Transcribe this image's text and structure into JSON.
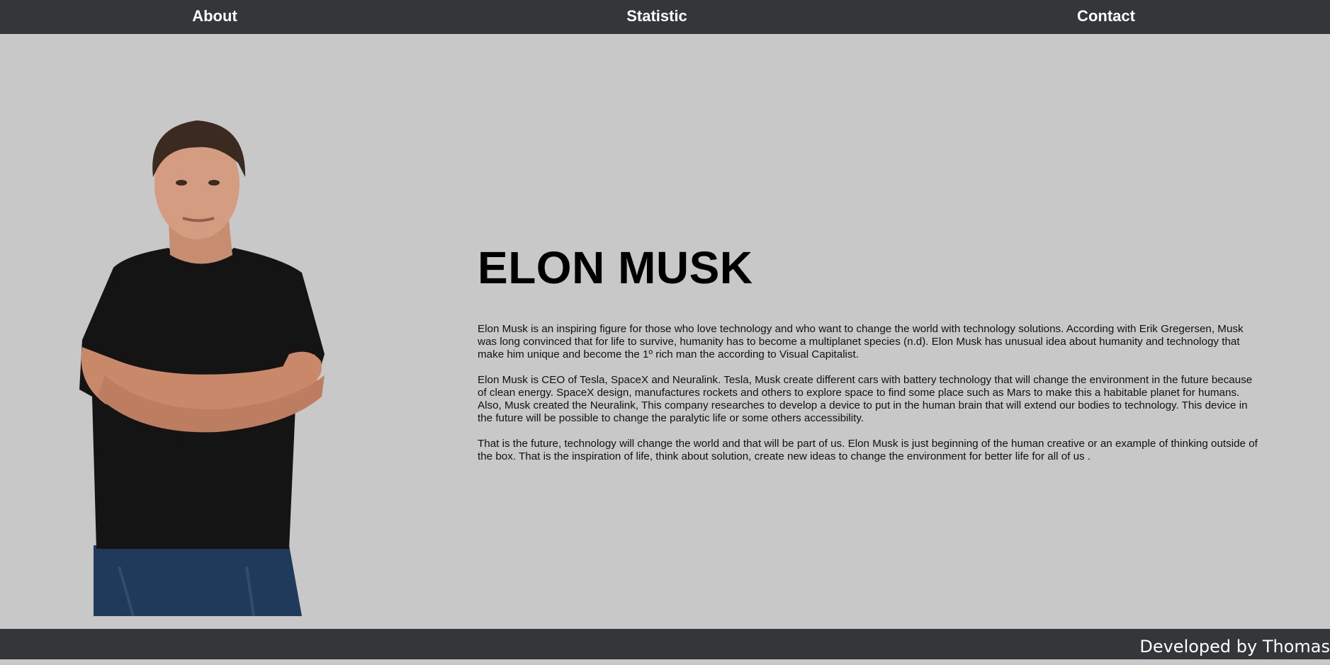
{
  "nav": {
    "about": "About",
    "statistic": "Statistic",
    "contact": "Contact"
  },
  "main": {
    "title": "ELON MUSK",
    "paragraphs": [
      "Elon Musk is an inspiring figure for those who love technology and who want to change the world with technology solutions. According with Erik Gregersen, Musk was long convinced that for life to survive, humanity has to become a multiplanet species (n.d). Elon Musk has unusual idea about humanity and technology that make him unique and become the 1º rich man the according to Visual Capitalist.",
      "Elon Musk is CEO of Tesla, SpaceX and Neuralink. Tesla, Musk create different cars with battery technology that will change the environment in the future because of clean energy. SpaceX design, manufactures rockets and others to explore space to find some place such as Mars to make this a habitable planet for humans. Also, Musk created the Neuralink, This company researches to develop a device to put in the human brain that will extend our bodies to technology. This device in the future will be possible to change the paralytic life or some others accessibility.",
      "That is the future, technology will change the world and that will be part of us. Elon Musk is just beginning of the human creative or an example of thinking outside of the box. That is the inspiration of life, think about solution, create new ideas to change the environment for better life for all of us ."
    ]
  },
  "footer": {
    "credit": "Developed by Thomas"
  },
  "colors": {
    "bar": "#33373a",
    "background": "#c8c8c8",
    "bar_text": "#ffffff"
  }
}
